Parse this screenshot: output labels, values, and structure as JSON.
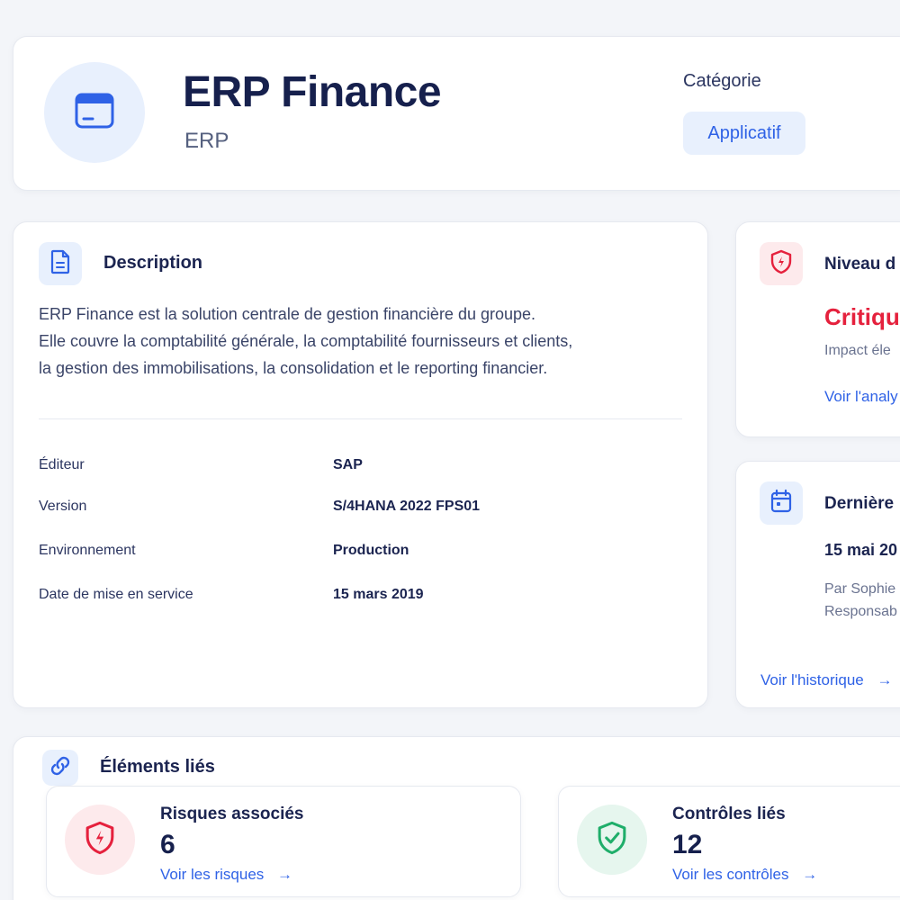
{
  "header": {
    "title": "ERP Finance",
    "subtitle": "ERP",
    "category_label": "Catégorie",
    "category_value": "Applicatif"
  },
  "description": {
    "title": "Description",
    "lines": [
      "ERP Finance est la solution centrale de gestion financière du groupe.",
      "Elle couvre la comptabilité générale, la comptabilité fournisseurs et clients,",
      "la gestion des immobilisations, la consolidation et le reporting financier."
    ],
    "details": [
      {
        "label": "Éditeur",
        "value": "SAP"
      },
      {
        "label": "Version",
        "value": "S/4HANA 2022 FPS01"
      },
      {
        "label": "Environnement",
        "value": "Production"
      },
      {
        "label": "Date de mise en service",
        "value": "15 mars 2019"
      }
    ]
  },
  "criticality": {
    "title": "Niveau d",
    "level": "Critique",
    "impact": "Impact éle",
    "link": "Voir l'analy",
    "level_color": "#e5213d"
  },
  "last_update": {
    "title": "Dernière",
    "date": "15 mai 20",
    "by_line1": "Par Sophie",
    "by_line2": "Responsab",
    "link": "Voir l'historique",
    "arrow": "→"
  },
  "linked": {
    "title": "Éléments liés",
    "risks": {
      "title": "Risques associés",
      "count": "6",
      "link": "Voir les risques",
      "arrow": "→"
    },
    "controls": {
      "title": "Contrôles liés",
      "count": "12",
      "link": "Voir les contrôles",
      "arrow": "→"
    }
  },
  "icons": {
    "app": "browser-window-icon",
    "description": "document-icon",
    "criticality": "shield-alert-icon",
    "calendar": "calendar-icon",
    "link": "link-icon",
    "risks": "shield-alert-icon",
    "controls": "shield-check-icon"
  },
  "colors": {
    "accent": "#2f62e6",
    "danger": "#e5213d",
    "success": "#1fae6a",
    "text_dark": "#1b2450"
  }
}
